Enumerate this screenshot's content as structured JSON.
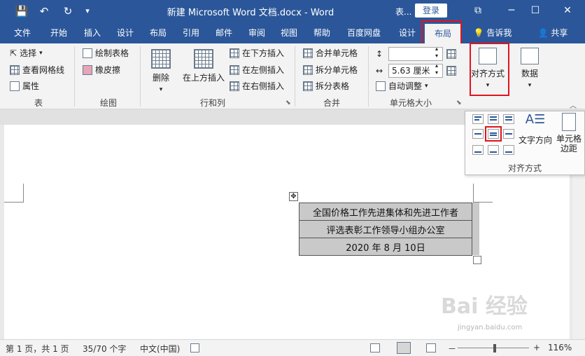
{
  "titlebar": {
    "title": "新建 Microsoft Word 文档.docx  -  Word",
    "share_truncated": "表...",
    "login": "登录",
    "qa_save": "💾",
    "qa_undo": "↶",
    "qa_redo": "↻",
    "qa_customize": "▾",
    "restore": "⧉",
    "minimize": "─",
    "maximize": "☐",
    "close": "✕"
  },
  "tabs": {
    "file": "文件",
    "home": "开始",
    "insert": "插入",
    "design": "设计",
    "layout": "布局",
    "references": "引用",
    "mailings": "邮件",
    "review": "审阅",
    "view": "视图",
    "help": "帮助",
    "baidu": "百度网盘",
    "table_design": "设计",
    "table_layout": "布局",
    "tellme": "告诉我",
    "share": "共享"
  },
  "ribbon": {
    "select": "选择",
    "view_gridlines": "查看网格线",
    "properties": "属性",
    "group_table": "表",
    "draw_table": "绘制表格",
    "eraser": "橡皮擦",
    "group_draw": "绘图",
    "delete": "删除",
    "insert_above": "在上方插入",
    "insert_below": "在下方插入",
    "insert_left": "在左侧插入",
    "insert_right": "在右侧插入",
    "group_rows_cols": "行和列",
    "merge_cells": "合并单元格",
    "split_cells": "拆分单元格",
    "split_table": "拆分表格",
    "group_merge": "合并",
    "height_value": "",
    "width_value": "5.63 厘米",
    "autofit": "自动调整",
    "group_cell_size": "单元格大小",
    "alignment": "对齐方式",
    "data": "数据"
  },
  "align_panel": {
    "text_direction": "文字方向",
    "cell_margins": "单元格边距",
    "label": "对齐方式"
  },
  "document": {
    "rows": [
      "全国价格工作先进集体和先进工作者",
      "评选表彰工作领导小组办公室",
      "2020 年 8 月 10日"
    ]
  },
  "statusbar": {
    "page": "第 1 页，共 1 页",
    "words": "35/70 个字",
    "language": "中文(中国)",
    "zoom_minus": "－",
    "zoom_plus": "+",
    "zoom": "116%"
  },
  "watermark": {
    "main": "Bai 经验",
    "sub": "jingyan.baidu.com"
  },
  "colors": {
    "accent": "#2b579a",
    "highlight_box": "#e0141e"
  }
}
